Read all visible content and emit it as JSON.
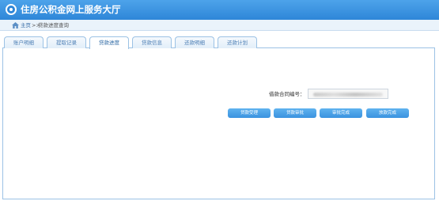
{
  "header": {
    "title": "住房公积金网上服务大厅"
  },
  "breadcrumb": {
    "home": "主页",
    "separator": ">>",
    "current": "贷款进度查询"
  },
  "tabs": [
    {
      "label": "账户明细",
      "active": false
    },
    {
      "label": "提取记录",
      "active": false
    },
    {
      "label": "贷款进度",
      "active": true
    },
    {
      "label": "贷款信息",
      "active": false
    },
    {
      "label": "还款明细",
      "active": false
    },
    {
      "label": "还款计划",
      "active": false
    }
  ],
  "form": {
    "contract_label": "借款合同编号：",
    "contract_value": ""
  },
  "steps": [
    {
      "label": "贷款受理"
    },
    {
      "label": "贷款审批"
    },
    {
      "label": "审批完成"
    },
    {
      "label": "放款完成"
    }
  ],
  "colors": {
    "header": "#2e86d8",
    "tab_border": "#9cc2e5",
    "step": "#4aa0e6"
  }
}
